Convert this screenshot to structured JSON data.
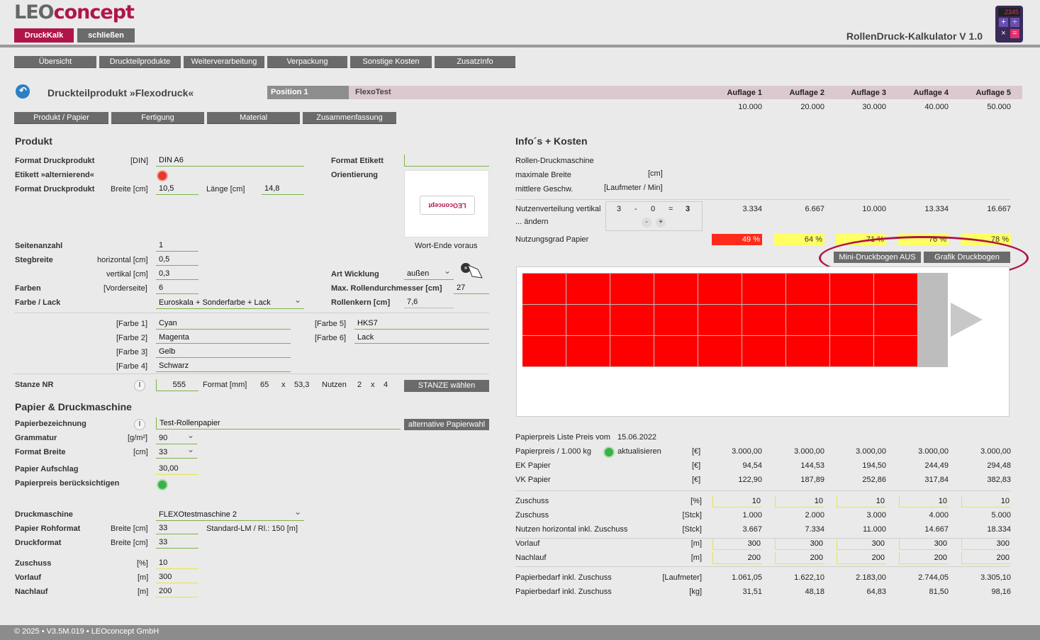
{
  "app": {
    "logo_a": "LEO",
    "logo_b": "concept",
    "title": "RollenDruck-Kalkulator V 1.0",
    "calc_display": "2345"
  },
  "topbuttons": {
    "druckkalk": "DruckKalk",
    "schliessen": "schließen"
  },
  "nav": [
    "Übersicht",
    "Druckteilprodukte",
    "Weiterverarbeitung",
    "Verpackung",
    "Sonstige Kosten",
    "ZusatzInfo"
  ],
  "header": {
    "product_title": "Druckteilprodukt »Flexodruck«",
    "position": "Position 1",
    "job": "FlexoTest"
  },
  "auflagen": {
    "labels": [
      "Auflage 1",
      "Auflage 2",
      "Auflage 3",
      "Auflage 4",
      "Auflage 5"
    ],
    "values": [
      "10.000",
      "20.000",
      "30.000",
      "40.000",
      "50.000"
    ]
  },
  "subtabs": [
    "Produkt / Papier",
    "Fertigung",
    "Material",
    "Zusammenfassung"
  ],
  "produkt": {
    "heading": "Produkt",
    "format_label": "Format Druckprodukt",
    "format_unit": "[DIN]",
    "format_value": "DIN A6",
    "etikett_label": "Etikett »alternierend«",
    "format2_label": "Format Druckprodukt",
    "breite_label": "Breite [cm]",
    "breite": "10,5",
    "laenge_label": "Länge [cm]",
    "laenge": "14,8",
    "format_etikett_label": "Format Etikett",
    "orientierung_label": "Orientierung",
    "wort_ende": "Wort-Ende voraus",
    "seiten_label": "Seitenanzahl",
    "seiten": "1",
    "steg_label": "Stegbreite",
    "horiz_label": "horizontal [cm]",
    "horiz": "0,5",
    "vert_label": "vertikal [cm]",
    "vert": "0,3",
    "farben_label": "Farben",
    "vorderseite": "[Vorderseite]",
    "farben": "6",
    "farbe_lack_label": "Farbe / Lack",
    "farbe_lack": "Euroskala + Sonderfarbe + Lack",
    "art_wicklung_label": "Art Wicklung",
    "art_wicklung": "außen",
    "rollen_label": "Max. Rollendurchmesser [cm]",
    "rollen": "27",
    "rollenkern_label": "Rollenkern [cm]",
    "rollenkern": "7,6",
    "colors": [
      {
        "l": "[Farbe 1]",
        "v": "Cyan"
      },
      {
        "l": "[Farbe 2]",
        "v": "Magenta"
      },
      {
        "l": "[Farbe 3]",
        "v": "Gelb"
      },
      {
        "l": "[Farbe 4]",
        "v": "Schwarz"
      },
      {
        "l": "[Farbe 5]",
        "v": "HKS7"
      },
      {
        "l": "[Farbe 6]",
        "v": "Lack"
      }
    ],
    "stanze_label": "Stanze NR",
    "stanze": "555",
    "stanze_format_label": "Format [mm]",
    "stanze_w": "65",
    "x": "x",
    "stanze_h": "53,3",
    "nutzen_label": "Nutzen",
    "nutzen_a": "2",
    "nutzen_b": "4",
    "stanze_btn": "STANZE wählen"
  },
  "papier": {
    "heading": "Papier & Druckmaschine",
    "bez_label": "Papierbezeichnung",
    "bez": "Test-Rollenpapier",
    "alt_btn": "alternative Papierwahl",
    "gram_label": "Grammatur",
    "gram_unit": "[g/m²]",
    "gram": "90",
    "fb_label": "Format Breite",
    "fb_unit": "[cm]",
    "fb": "33",
    "aufschlag_label": "Papier Aufschlag",
    "aufschlag": "30,00",
    "preis_label": "Papierpreis berücksichtigen",
    "dm_label": "Druckmaschine",
    "dm": "FLEXOtestmaschine 2",
    "roh_label": "Papier Rohformat",
    "roh_breite": "Breite [cm]",
    "roh": "33",
    "std": "Standard-LM / Rl.: 150 [m]",
    "df_label": "Druckformat",
    "df_breite": "Breite [cm]",
    "df": "33",
    "zuschuss_label": "Zuschuss",
    "zuschuss_unit": "[%]",
    "zuschuss": "10",
    "vorlauf_label": "Vorlauf",
    "vorlauf_unit": "[m]",
    "vorlauf": "300",
    "nachlauf_label": "Nachlauf",
    "nachlauf_unit": "[m]",
    "nachlauf": "200"
  },
  "info": {
    "heading": "Info´s + Kosten",
    "rdm": "Rollen-Druckmaschine",
    "maxb": "maximale Breite",
    "maxb_unit": "[cm]",
    "mg": "mittlere Geschw.",
    "mg_unit": "[Laufmeter / Min]",
    "nv_label": "Nutzenverteilung vertikal",
    "aendern": "... ändern",
    "nv": [
      "3",
      "-",
      "0",
      "=",
      "3"
    ],
    "nv_vals": [
      "3.334",
      "6.667",
      "10.000",
      "13.334",
      "16.667"
    ],
    "ng_label": "Nutzungsgrad Papier",
    "ng_vals": [
      "49 %",
      "64 %",
      "71 %",
      "76 %",
      "78 %"
    ],
    "ng_colors": [
      "#ff2a1a",
      "#ffff66",
      "#ffff66",
      "#ffff66",
      "#ffff66"
    ],
    "mini_btn": "Mini-Druckbogen AUS",
    "grafik_btn": "Grafik Druckbogen",
    "pl_label": "Papierpreis Liste Preis vom",
    "pl_date": "15.06.2022",
    "rows": [
      {
        "l": "Papierpreis / 1.000 kg",
        "u": "[€]",
        "v": [
          "3.000,00",
          "3.000,00",
          "3.000,00",
          "3.000,00",
          "3.000,00"
        ]
      },
      {
        "l": "EK Papier",
        "u": "[€]",
        "v": [
          "94,54",
          "144,53",
          "194,50",
          "244,49",
          "294,48"
        ]
      },
      {
        "l": "VK Papier",
        "u": "[€]",
        "v": [
          "122,90",
          "187,89",
          "252,86",
          "317,84",
          "382,83"
        ]
      }
    ],
    "aktualisieren": "aktualisieren",
    "rows2": [
      {
        "l": "Zuschuss",
        "u": "[%]",
        "v": [
          "10",
          "10",
          "10",
          "10",
          "10"
        ],
        "y": true
      },
      {
        "l": "Zuschuss",
        "u": "[Stck]",
        "v": [
          "1.000",
          "2.000",
          "3.000",
          "4.000",
          "5.000"
        ]
      },
      {
        "l": "Nutzen horizontal inkl. Zuschuss",
        "u": "[Stck]",
        "v": [
          "3.667",
          "7.334",
          "11.000",
          "14.667",
          "18.334"
        ]
      },
      {
        "l": "Vorlauf",
        "u": "[m]",
        "v": [
          "300",
          "300",
          "300",
          "300",
          "300"
        ],
        "y": true
      },
      {
        "l": "Nachlauf",
        "u": "[m]",
        "v": [
          "200",
          "200",
          "200",
          "200",
          "200"
        ],
        "y": true
      },
      {
        "l": "Papierbedarf inkl. Zuschuss",
        "u": "[Laufmeter]",
        "v": [
          "1.061,05",
          "1.622,10",
          "2.183,00",
          "2.744,05",
          "3.305,10"
        ]
      },
      {
        "l": "Papierbedarf inkl. Zuschuss",
        "u": "[kg]",
        "v": [
          "31,51",
          "48,18",
          "64,83",
          "81,50",
          "98,16"
        ]
      }
    ]
  },
  "footer": "© 2025 • V3.5M.019 • LEOconcept GmbH"
}
